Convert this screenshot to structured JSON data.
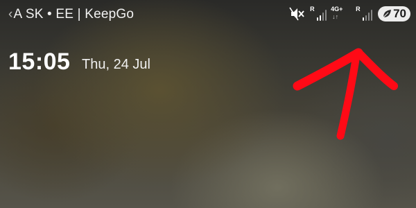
{
  "status_bar": {
    "back_glyph": "‹",
    "carrier_text": "A SK • EE | KeepGo",
    "sim1_roaming": "R",
    "sim2_network": "4G+",
    "sim2_roaming": "R",
    "data_arrows": "↓↑",
    "battery_percent": "70",
    "battery_mode_icon": "leaf-icon",
    "mute_icon": "mute-icon",
    "icon_color": "#ffffff"
  },
  "lockscreen": {
    "time": "15:05",
    "date": "Thu, 24 Jul"
  },
  "annotation": {
    "type": "hand-drawn-arrow",
    "direction": "up",
    "color": "#ff0a16"
  }
}
